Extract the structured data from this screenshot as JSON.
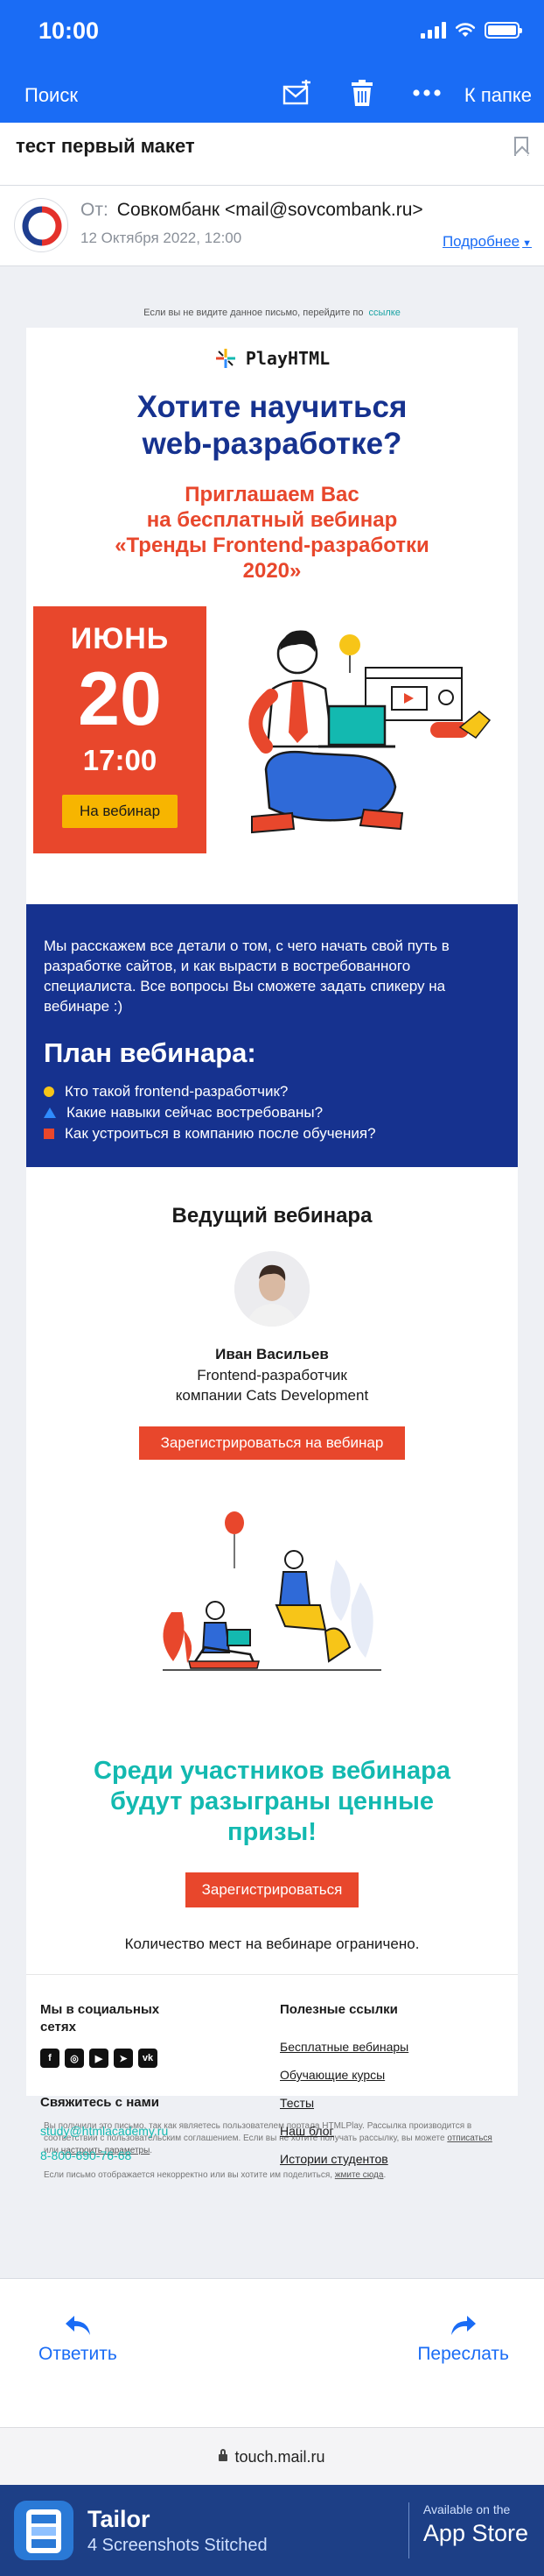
{
  "status_bar": {
    "time": "10:00"
  },
  "nav": {
    "back_label": "Поиск",
    "folder_label": "К папке"
  },
  "message": {
    "subject": "тест первый макет",
    "from_label": "От:",
    "from_value": "Совкомбанк <mail@sovcombank.ru>",
    "date": "12 Октября 2022, 12:00",
    "details_link": "Подробнее"
  },
  "email": {
    "view_note": "Если вы не видите данное письмо, перейдите по",
    "view_link": "ссылке",
    "logo_text": "PlayHTML",
    "hero_title_line1": "Хотите научиться",
    "hero_title_line2": "web-разработке?",
    "hero_sub_line1": "Приглашаем Вас",
    "hero_sub_line2": "на бесплатный вебинар",
    "hero_sub_line3": "«Тренды Frontend-разработки",
    "hero_sub_line4": "2020»",
    "date_month": "ИЮНЬ",
    "date_day": "20",
    "date_time": "17:00",
    "date_button": "На вебинар",
    "intro_text": "Мы расскажем все детали о том, с чего начать свой путь в разработке сайтов, и как вырасти в востребованного специалиста. Все вопросы Вы сможете задать спикеру на вебинаре :)",
    "plan_title": "План вебинара:",
    "plan_items": [
      "Кто такой frontend-разработчик?",
      "Какие навыки сейчас востребованы?",
      "Как устроиться в компанию после обучения?"
    ],
    "speaker_heading": "Ведущий вебинара",
    "speaker_name": "Иван Васильев",
    "speaker_role_line1": "Frontend-разработчик",
    "speaker_role_line2": "компании Cats Development",
    "register_webinar_button": "Зарегистрироваться на вебинар",
    "prize_line1": "Среди участников вебинара",
    "prize_line2": "будут разыграны ценные",
    "prize_line3": "призы!",
    "register_button": "Зарегистрироваться",
    "limit_note": "Количество мест на вебинаре ограничено.",
    "social_heading_line1": "Мы в социальных",
    "social_heading_line2": "сетях",
    "contact_heading": "Свяжитесь с нами",
    "contact_email": "study@htmlacademy.ru",
    "contact_phone": "8-800-690-76-68",
    "useful_heading": "Полезные ссылки",
    "useful_links": [
      "Бесплатные вебинары",
      "Обучающие курсы",
      "Тесты",
      "Наш блог",
      "Истории студентов"
    ],
    "legal_text_1": "Вы получили это письмо, так как являетесь пользователем портала HTMLPlay. Рассылка производится в соответствии с пользовательским соглашением. Если вы не хотите получать рассылку, вы можете",
    "legal_link_unsub": "отписаться",
    "legal_text_or": "или",
    "legal_link_settings": "настроить параметры",
    "legal_text_2": "Если письмо отображается некорректно или вы хотите им поделиться,",
    "legal_link_click": "жмите сюда"
  },
  "actions": {
    "reply": "Ответить",
    "forward": "Переслать"
  },
  "browser": {
    "url": "touch.mail.ru"
  },
  "promo": {
    "title": "Tailor",
    "subtitle": "4 Screenshots Stitched",
    "store_top": "Available on the",
    "store_name": "App Store"
  },
  "colors": {
    "accent_blue": "#1a6cf5",
    "brand_navy": "#16328f",
    "brand_red": "#e8472c",
    "brand_teal": "#13b9b0",
    "brand_yellow": "#f7b500"
  }
}
